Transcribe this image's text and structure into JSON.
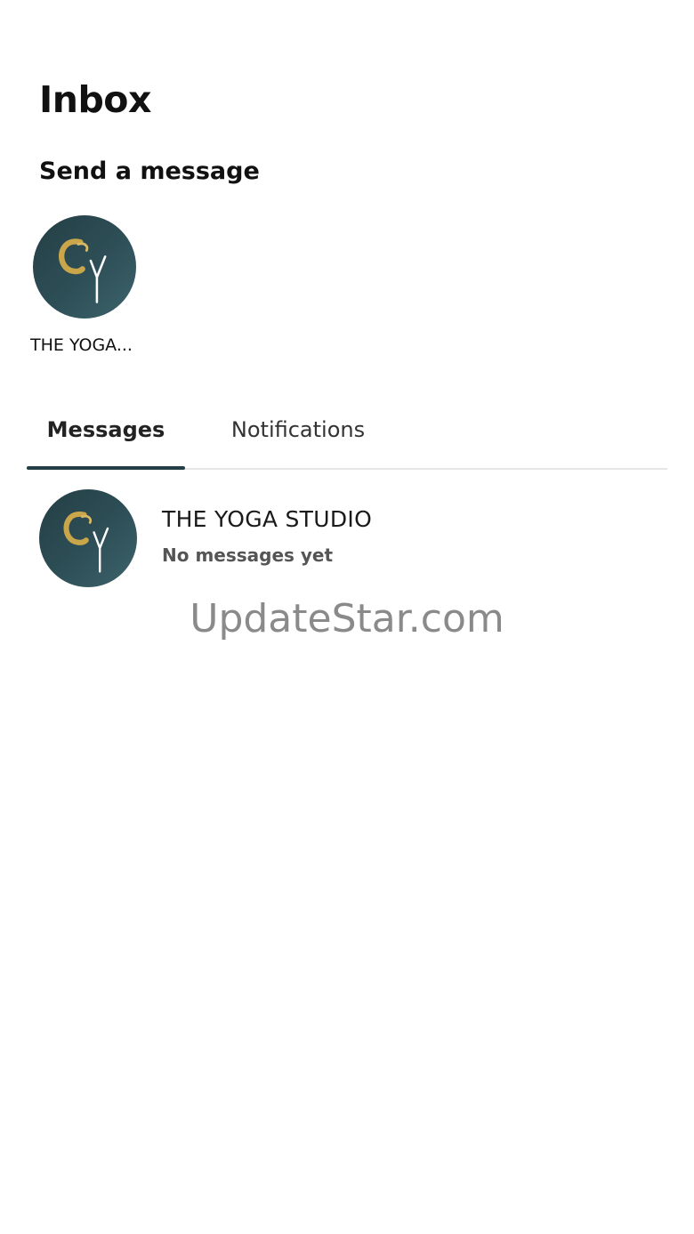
{
  "header": {
    "title": "Inbox"
  },
  "send_message": {
    "title": "Send a message",
    "contacts": [
      {
        "name": "THE YOGA...",
        "avatar_icon": "yoga-studio-logo-icon"
      }
    ]
  },
  "tabs": [
    {
      "label": "Messages",
      "active": true
    },
    {
      "label": "Notifications",
      "active": false
    }
  ],
  "conversations": [
    {
      "name": "THE YOGA STUDIO",
      "preview": "No messages yet",
      "avatar_icon": "yoga-studio-logo-icon"
    }
  ],
  "watermark": "UpdateStar.com",
  "colors": {
    "avatar_bg": "#2e4f57",
    "logo_gold": "#c9a64a",
    "tab_indicator": "#243e45"
  }
}
